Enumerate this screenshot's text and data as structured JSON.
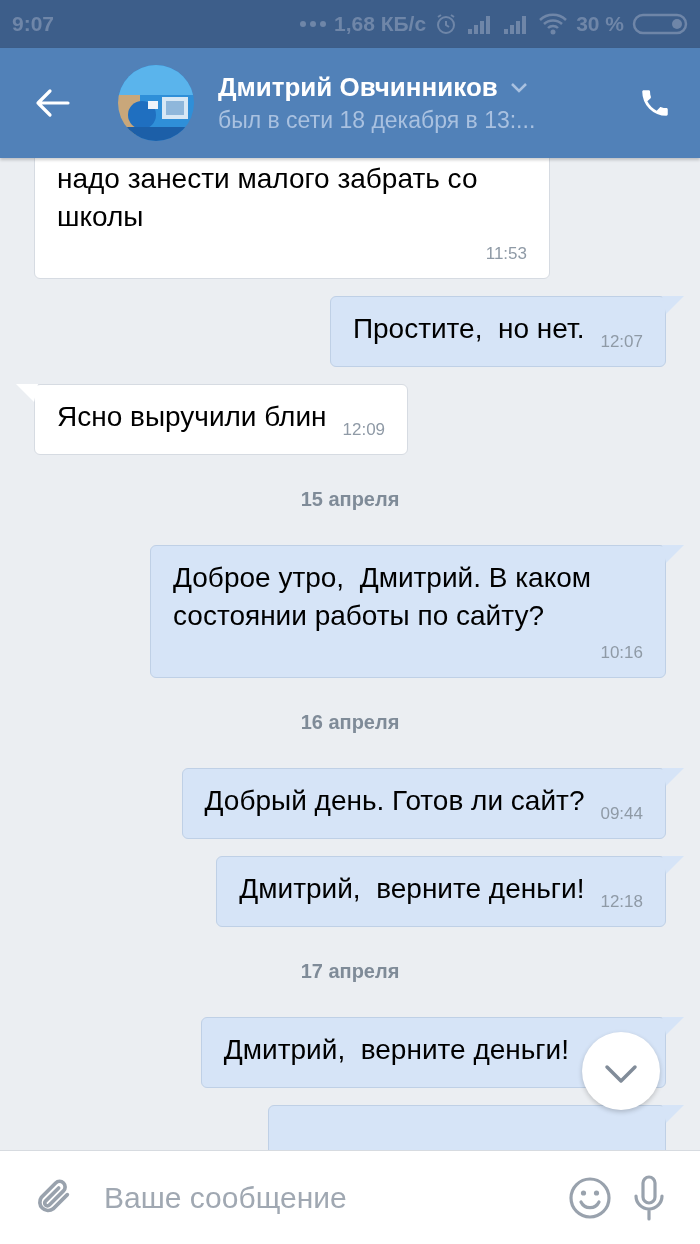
{
  "status_bar": {
    "time": "9:07",
    "speed": "1,68 КБ/с",
    "battery": "30 %"
  },
  "header": {
    "name": "Дмитрий Овчинников",
    "status": "был в сети 18 декабря в 13:..."
  },
  "messages": [
    {
      "kind": "incoming",
      "text": "надо занести малого забрать со школы",
      "time": "11:53"
    },
    {
      "kind": "outgoing",
      "text": "Простите,  но нет.",
      "time": "12:07"
    },
    {
      "kind": "incoming",
      "text": "Ясно выручили блин",
      "time": "12:09"
    },
    {
      "kind": "date",
      "text": "15 апреля"
    },
    {
      "kind": "outgoing",
      "text": "Доброе утро,  Дмитрий. В каком состоянии работы по сайту?",
      "time": "10:16"
    },
    {
      "kind": "date",
      "text": "16 апреля"
    },
    {
      "kind": "outgoing",
      "text": "Добрый день. Готов ли сайт?",
      "time": "09:44"
    },
    {
      "kind": "outgoing",
      "text": "Дмитрий,  верните деньги!",
      "time": "12:18"
    },
    {
      "kind": "date",
      "text": "17 апреля"
    },
    {
      "kind": "outgoing",
      "text": "Дмитрий,  верните деньги!"
    },
    {
      "kind": "outgoing"
    }
  ],
  "composer": {
    "placeholder": "Ваше сообщение"
  }
}
